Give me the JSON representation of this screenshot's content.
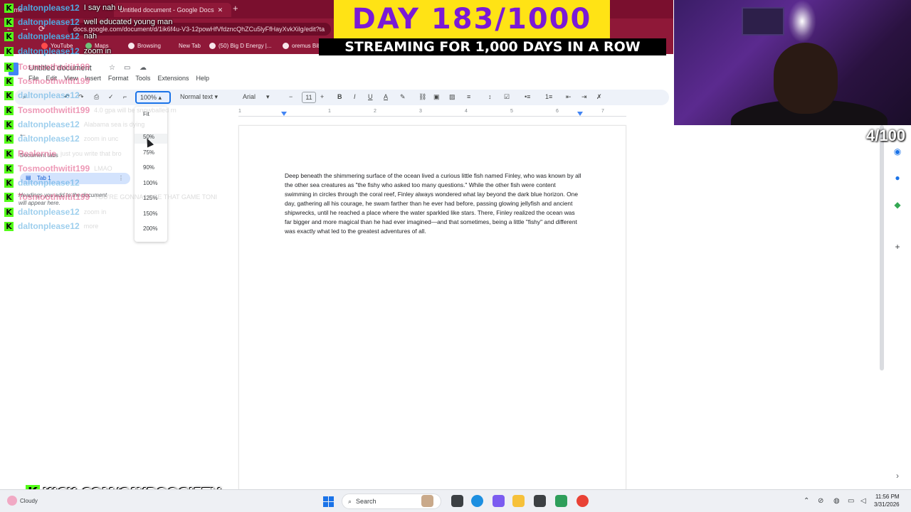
{
  "browser": {
    "tabs": [
      {
        "label": "Home"
      },
      {
        "label": "Untitled document - Google Docs",
        "active": true
      }
    ],
    "new_tab": "+",
    "address": "docs.google.com/document/d/1ik6f4u-V3-12powHfVfdzncQhZCu5lyFfHayXvkXilg/edit?ta",
    "bookmarks": [
      "YouTube",
      "Maps",
      "Browsing",
      "New Tab",
      "(50) Big D Energy |...",
      "oremus Bib"
    ]
  },
  "docs": {
    "title": "Untitled document",
    "menu": [
      "File",
      "Edit",
      "View",
      "Insert",
      "Format",
      "Tools",
      "Extensions",
      "Help"
    ],
    "toolbar": {
      "zoom": "100%",
      "style": "Normal text",
      "font": "Arial",
      "font_size": "11",
      "minus": "−",
      "plus": "+",
      "bold": "B",
      "italic": "I",
      "underline": "U"
    },
    "ruler_numbers": [
      "1",
      "1",
      "2",
      "3",
      "4",
      "5",
      "6",
      "7"
    ],
    "zoom_menu": [
      "Fit",
      "50%",
      "75%",
      "90%",
      "100%",
      "125%",
      "150%",
      "200%"
    ],
    "left_panel": {
      "heading": "Document tabs",
      "tab": "Tab 1",
      "hint_line1": "Headings you add to the document",
      "hint_line2": "will appear here."
    },
    "body": "Deep beneath the shimmering surface of the ocean lived a curious little fish named Finley, who was known by all the other sea creatures as \"the fishy who asked too many questions.\" While the other fish were content swimming in circles through the coral reef, Finley always wondered what lay beyond the dark blue horizon. One day, gathering all his courage, he swam farther than he ever had before, passing glowing jellyfish and ancient shipwrecks, until he reached a place where the water sparkled like stars. There, Finley realized the ocean was far bigger and more magical than he had ever imagined—and that sometimes, being a little \"fishy\" and different was exactly what led to the greatest adventures of all."
  },
  "chat": [
    {
      "user": "daltonplease12",
      "msg": "I say nah u",
      "color": "#4fa8e0"
    },
    {
      "user": "daltonplease12",
      "msg": "well educated young man",
      "color": "#4fa8e0"
    },
    {
      "user": "daltonplease12",
      "msg": "nah",
      "color": "#4fa8e0"
    },
    {
      "user": "daltonplease12",
      "msg": "zoom in",
      "color": "#4fa8e0"
    },
    {
      "user": "Tosmoothwitit199",
      "msg": "",
      "color": "#e0457b",
      "dim": true
    },
    {
      "user": "Tosmoothwitit199",
      "msg": "",
      "color": "#e0457b",
      "dim": true
    },
    {
      "user": "daltonplease12",
      "msg": "",
      "color": "#4fa8e0",
      "dim": true
    },
    {
      "user": "Tosmoothwitit199",
      "msg": "4.0 gpa will be snowballed rn",
      "color": "#e0457b",
      "dim": true
    },
    {
      "user": "daltonplease12",
      "msg": "Alabama sea is dying",
      "color": "#4fa8e0",
      "dim": true
    },
    {
      "user": "daltonplease12",
      "msg": "zoom in unc",
      "color": "#4fa8e0",
      "dim": true
    },
    {
      "user": "Realernie",
      "msg": "just you write that bro",
      "color": "#e0457b",
      "dim": true
    },
    {
      "user": "Tosmoothwitit199",
      "msg": "LMAO",
      "color": "#e0457b",
      "dim": true
    },
    {
      "user": "daltonplease12",
      "msg": "",
      "color": "#4fa8e0",
      "dim": true
    },
    {
      "user": "Tosmoothwitit199",
      "msg": "YOU'RE GONNA LOSE THAT GAME TONI",
      "color": "#e0457b",
      "dim": true
    },
    {
      "user": "daltonplease12",
      "msg": "zoom in",
      "color": "#4fa8e0",
      "dim": true
    },
    {
      "user": "daltonplease12",
      "msg": "more",
      "color": "#4fa8e0",
      "dim": true
    }
  ],
  "stream": {
    "day": "DAY 183/1000",
    "tagline": "STREAMING FOR 1,000 DAYS IN A ROW",
    "counter": "4/100",
    "kick_url": "KICK.COM/CAYBOOGIETV",
    "kick_letter": "K"
  },
  "taskbar": {
    "weather": "Cloudy",
    "search": "Search",
    "time": "11:56 PM",
    "date": "3/31/2026"
  }
}
